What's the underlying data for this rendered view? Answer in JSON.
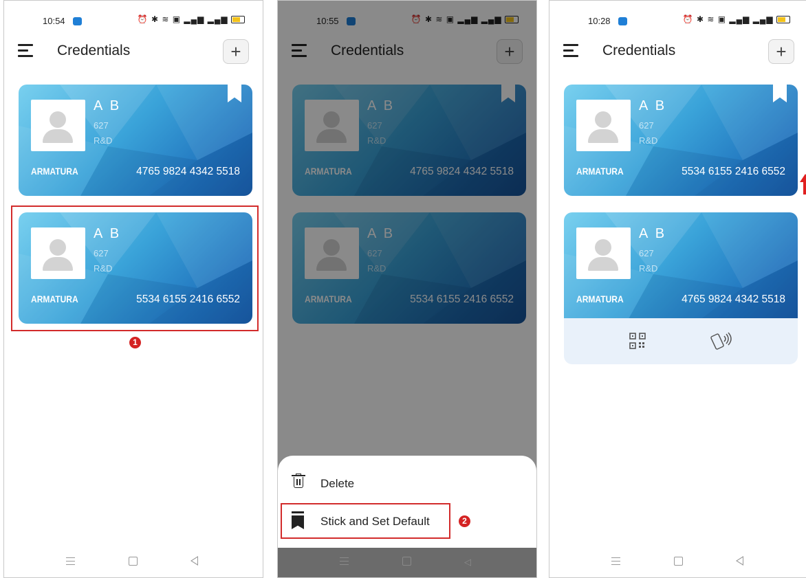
{
  "colors": {
    "highlight": "#d22b2b",
    "card_light": "#79d0ef",
    "card_dark": "#1b5ea8",
    "accent": "#1f7fd6"
  },
  "screens": [
    {
      "time": "10:54",
      "title": "Credentials",
      "add_label": "+",
      "cards": [
        {
          "name": "A B",
          "id": "627",
          "dept": "R&D",
          "brand": "ARMATURA",
          "number": "4765 9824 4342 5518",
          "bookmarked": true
        },
        {
          "name": "A B",
          "id": "627",
          "dept": "R&D",
          "brand": "ARMATURA",
          "number": "5534 6155 2416 6552",
          "bookmarked": false
        }
      ],
      "step_badge": "1"
    },
    {
      "time": "10:55",
      "title": "Credentials",
      "add_label": "+",
      "cards": [
        {
          "name": "A B",
          "id": "627",
          "dept": "R&D",
          "brand": "ARMATURA",
          "number": "4765 9824 4342 5518",
          "bookmarked": true
        },
        {
          "name": "A B",
          "id": "627",
          "dept": "R&D",
          "brand": "ARMATURA",
          "number": "5534 6155 2416 6552",
          "bookmarked": false
        }
      ],
      "sheet": {
        "delete_label": "Delete",
        "stick_label": "Stick and Set Default"
      },
      "step_badge": "2"
    },
    {
      "time": "10:28",
      "title": "Credentials",
      "add_label": "+",
      "cards": [
        {
          "name": "A B",
          "id": "627",
          "dept": "R&D",
          "brand": "ARMATURA",
          "number": "5534 6155 2416 6552",
          "bookmarked": true
        },
        {
          "name": "A B",
          "id": "627",
          "dept": "R&D",
          "brand": "ARMATURA",
          "number": "4765 9824 4342 5518",
          "bookmarked": false
        }
      ]
    }
  ]
}
